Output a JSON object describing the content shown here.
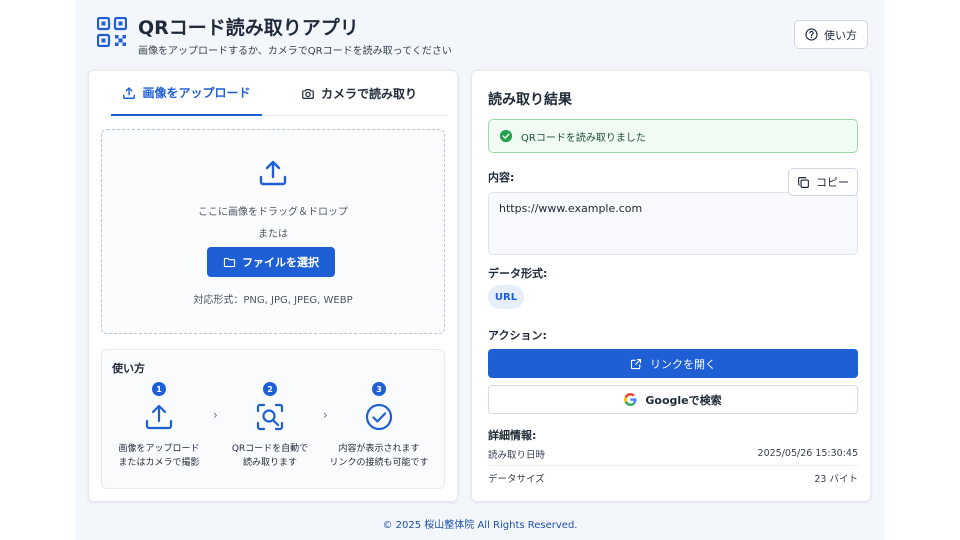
{
  "header": {
    "title": "QRコード読み取りアプリ",
    "subtitle": "画像をアップロードするか、カメラでQRコードを読み取ってください",
    "help_label": "使い方"
  },
  "tabs": [
    {
      "label": "画像をアップロード",
      "icon": "upload-icon",
      "active": true
    },
    {
      "label": "カメラで読み取り",
      "icon": "camera-icon",
      "active": false
    }
  ],
  "dropzone": {
    "line1": "ここに画像をドラッグ＆ドロップ",
    "line2": "または",
    "button_label": "ファイルを選択",
    "formats": "対応形式：PNG, JPG, JPEG, WEBP"
  },
  "howto": {
    "title": "使い方",
    "steps": [
      {
        "num": "1",
        "line1": "画像をアップロード",
        "line2": "またはカメラで撮影",
        "icon": "upload-icon"
      },
      {
        "num": "2",
        "line1": "QRコードを自動で",
        "line2": "読み取ります",
        "icon": "scan-search-icon"
      },
      {
        "num": "3",
        "line1": "内容が表示されます",
        "line2": "リンクの接続も可能です",
        "icon": "check-circle-icon"
      }
    ]
  },
  "result": {
    "title": "読み取り結果",
    "success_message": "QRコードを読み取りました",
    "content_label": "内容:",
    "copy_label": "コピー",
    "content_value": "https://www.example.com",
    "format_label": "データ形式:",
    "format_value": "URL",
    "action_label": "アクション:",
    "open_link_label": "リンクを開く",
    "google_search_label": "Googleで検索",
    "details_label": "詳細情報:",
    "details": [
      {
        "key": "読み取り日時",
        "value": "2025/05/26 15:30:45"
      },
      {
        "key": "データサイズ",
        "value": "23 バイト"
      }
    ]
  },
  "footer": "© 2025 桜山整体院  All Rights Reserved.",
  "colors": {
    "accent": "#1e5fd6",
    "success_bg": "#f0fbf3",
    "success_border": "#9bd6ac",
    "page_bg": "#f3f6fb"
  }
}
